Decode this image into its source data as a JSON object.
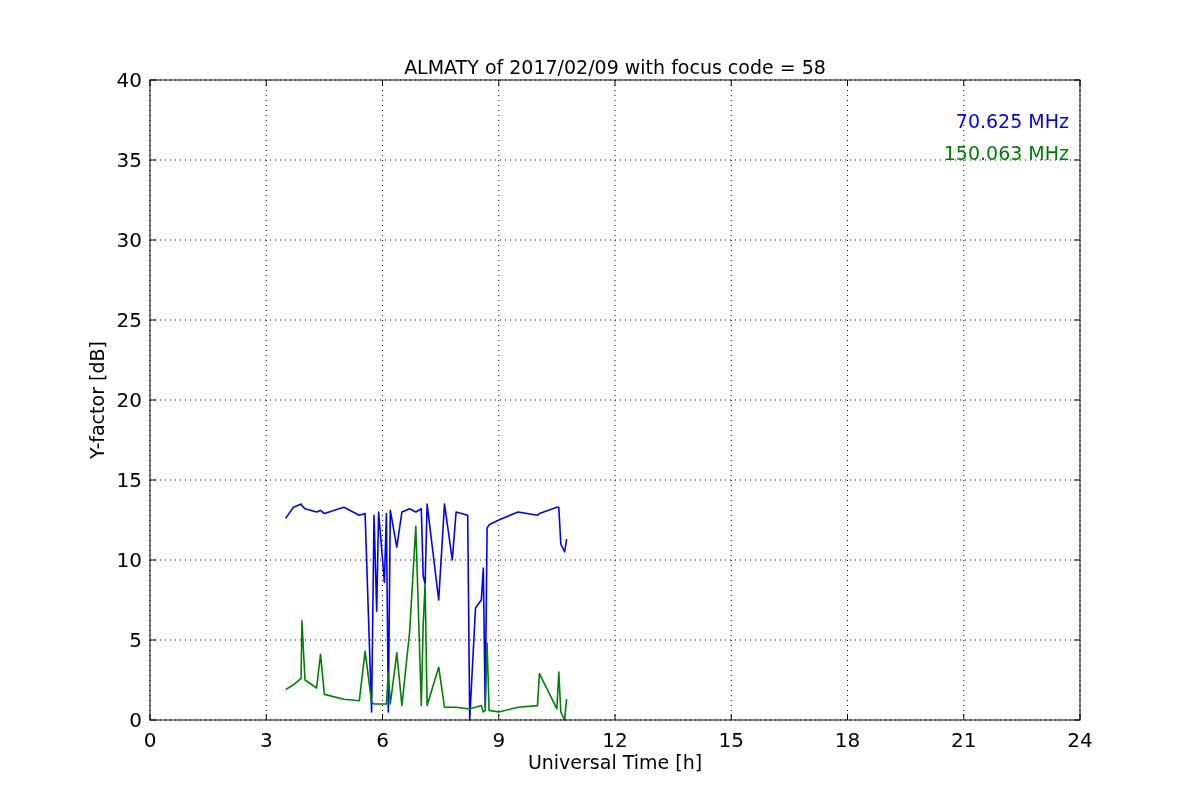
{
  "chart_data": {
    "type": "line",
    "title": "ALMATY of 2017/02/09 with focus code = 58",
    "xlabel": "Universal Time [h]",
    "ylabel": "Y-factor [dB]",
    "x": [
      3.5,
      3.7,
      3.9,
      3.92,
      4.0,
      4.3,
      4.4,
      4.5,
      5.0,
      5.4,
      5.55,
      5.72,
      5.78,
      5.85,
      5.9,
      6.05,
      6.1,
      6.15,
      6.2,
      6.37,
      6.5,
      6.7,
      6.86,
      7.0,
      7.05,
      7.1,
      7.15,
      7.45,
      7.6,
      7.8,
      7.9,
      8.2,
      8.25,
      8.4,
      8.55,
      8.6,
      8.65,
      8.7,
      8.75,
      9.0,
      9.5,
      10.0,
      10.05,
      10.5,
      10.55,
      10.6,
      10.7,
      10.75
    ],
    "series": [
      {
        "name": "70.625 MHz",
        "color": "#0000ff",
        "values": [
          12.6,
          13.3,
          13.5,
          13.4,
          13.2,
          13.0,
          13.1,
          12.9,
          13.3,
          12.8,
          12.9,
          0.5,
          12.8,
          6.8,
          13.0,
          8.6,
          12.9,
          0.5,
          13.1,
          10.8,
          13.0,
          13.2,
          13.0,
          13.2,
          9.0,
          8.5,
          13.5,
          7.5,
          13.5,
          10.0,
          13.0,
          12.8,
          0.0,
          7.0,
          7.5,
          9.5,
          0.8,
          12.0,
          12.2,
          12.5,
          13.0,
          12.8,
          12.9,
          13.3,
          13.3,
          11.0,
          10.5,
          11.3
        ]
      },
      {
        "name": "150.063 MHz",
        "color": "#008000",
        "values": [
          1.9,
          2.2,
          2.6,
          6.2,
          2.5,
          2.0,
          4.1,
          1.6,
          1.3,
          1.2,
          4.3,
          1.1,
          1.0,
          1.0,
          1.0,
          1.0,
          1.0,
          3.0,
          1.0,
          4.2,
          0.9,
          5.5,
          12.1,
          0.9,
          6.0,
          8.5,
          0.9,
          3.3,
          0.8,
          0.8,
          0.8,
          0.7,
          0.7,
          0.8,
          0.9,
          0.5,
          0.6,
          4.8,
          0.6,
          0.5,
          0.8,
          0.9,
          2.9,
          0.7,
          3.0,
          0.5,
          0.0,
          1.3
        ]
      }
    ],
    "xlim": [
      0,
      24
    ],
    "ylim": [
      0,
      40
    ],
    "xticks": [
      0,
      3,
      6,
      9,
      12,
      15,
      18,
      21,
      24
    ],
    "yticks": [
      0,
      5,
      10,
      15,
      20,
      25,
      30,
      35,
      40
    ],
    "grid": true
  }
}
